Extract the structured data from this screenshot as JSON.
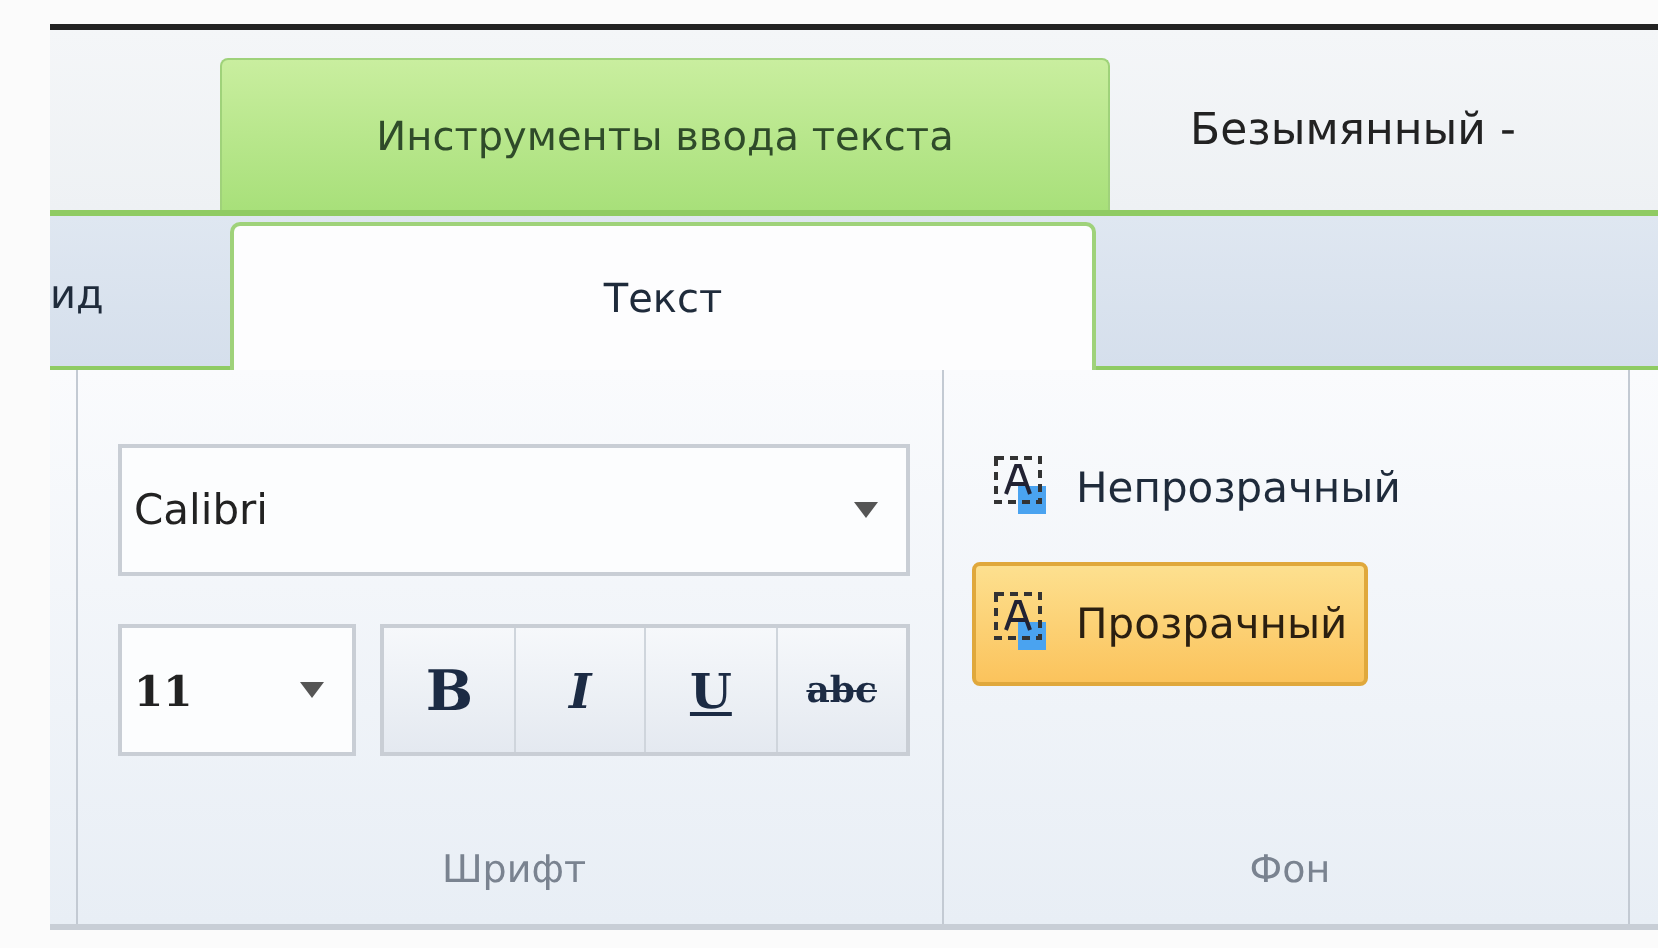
{
  "title_bar": {
    "contextual_tab": "Инструменты ввода текста",
    "document_title": "Безымянный -"
  },
  "tabs": [
    {
      "label": "ид",
      "selected": false
    },
    {
      "label": "Текст",
      "selected": true
    }
  ],
  "font_group": {
    "label": "Шрифт",
    "font_family": "Calibri",
    "font_size": "11",
    "style_buttons": [
      {
        "kind": "bold",
        "label": "B"
      },
      {
        "kind": "italic",
        "label": "I"
      },
      {
        "kind": "underline",
        "label": "U"
      },
      {
        "kind": "strikethrough",
        "label": "abc"
      }
    ]
  },
  "background_group": {
    "label": "Фон",
    "options": [
      {
        "label": "Непрозрачный",
        "selected": false
      },
      {
        "label": "Прозрачный",
        "selected": true
      }
    ]
  }
}
